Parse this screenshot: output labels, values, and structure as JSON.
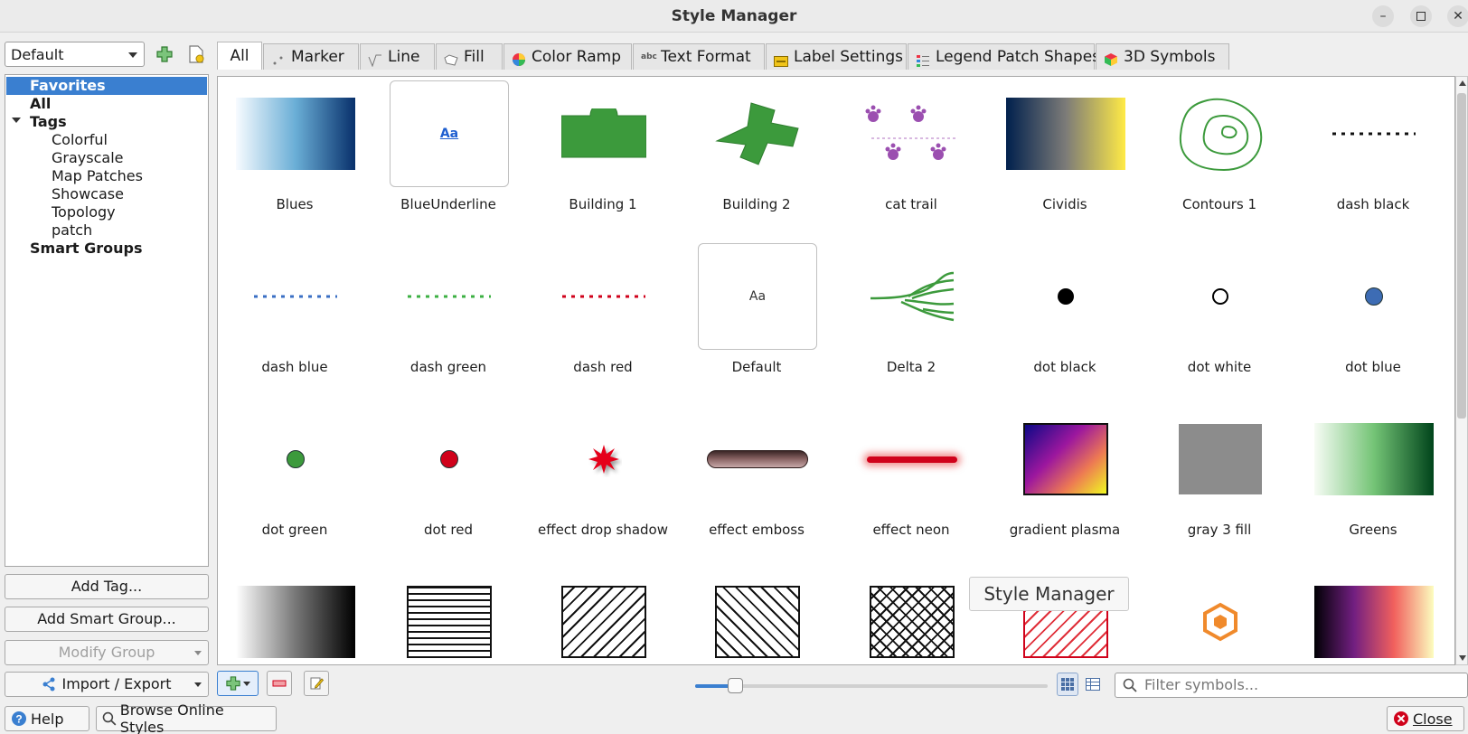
{
  "window": {
    "title": "Style Manager"
  },
  "style_select": {
    "value": "Default"
  },
  "tree": {
    "items": [
      {
        "label": "Favorites",
        "selected": true
      },
      {
        "label": "All"
      },
      {
        "label": "Tags"
      },
      {
        "label": "Colorful"
      },
      {
        "label": "Grayscale"
      },
      {
        "label": "Map Patches"
      },
      {
        "label": "Showcase"
      },
      {
        "label": "Topology"
      },
      {
        "label": "patch"
      },
      {
        "label": "Smart Groups"
      }
    ]
  },
  "left_buttons": {
    "add_tag": "Add Tag...",
    "add_smart_group": "Add Smart Group...",
    "modify_group": "Modify Group",
    "import_export": "Import / Export"
  },
  "tabs": [
    "All",
    "Marker",
    "Line",
    "Fill",
    "Color Ramp",
    "Text Format",
    "Label Settings",
    "Legend Patch Shapes",
    "3D Symbols"
  ],
  "active_tab": "All",
  "symbols": [
    "Blues",
    "BlueUnderline",
    "Building 1",
    "Building 2",
    "cat trail",
    "Cividis",
    "Contours 1",
    "dash  black",
    "dash blue",
    "dash green",
    "dash red",
    "Default",
    "Delta 2",
    "dot  black",
    "dot  white",
    "dot blue",
    "dot green",
    "dot red",
    "effect drop shadow",
    "effect emboss",
    "effect neon",
    "gradient  plasma",
    "gray 3 fill",
    "Greens"
  ],
  "tooltip": "Style Manager",
  "filter": {
    "placeholder": "Filter symbols..."
  },
  "footer": {
    "help": "Help",
    "browse": "Browse Online Styles",
    "close": "Close"
  },
  "colors": {
    "accent": "#3a7fd0",
    "green": "#3c9a3c",
    "red": "#d0021b"
  }
}
